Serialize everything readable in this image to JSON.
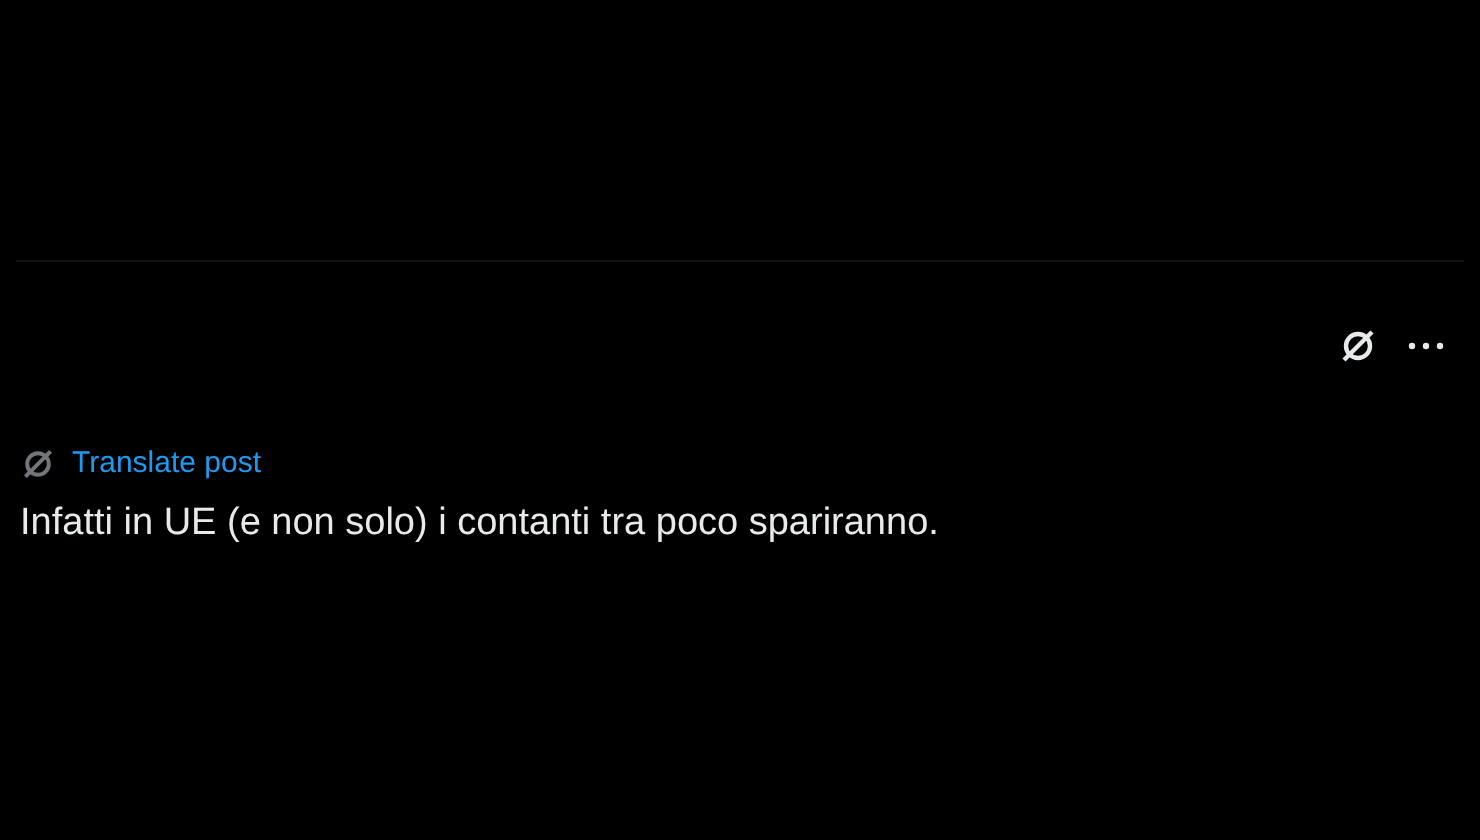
{
  "post": {
    "translate_link": "Translate post",
    "text": "Infatti in UE (e non solo) i contanti tra poco spariranno."
  }
}
